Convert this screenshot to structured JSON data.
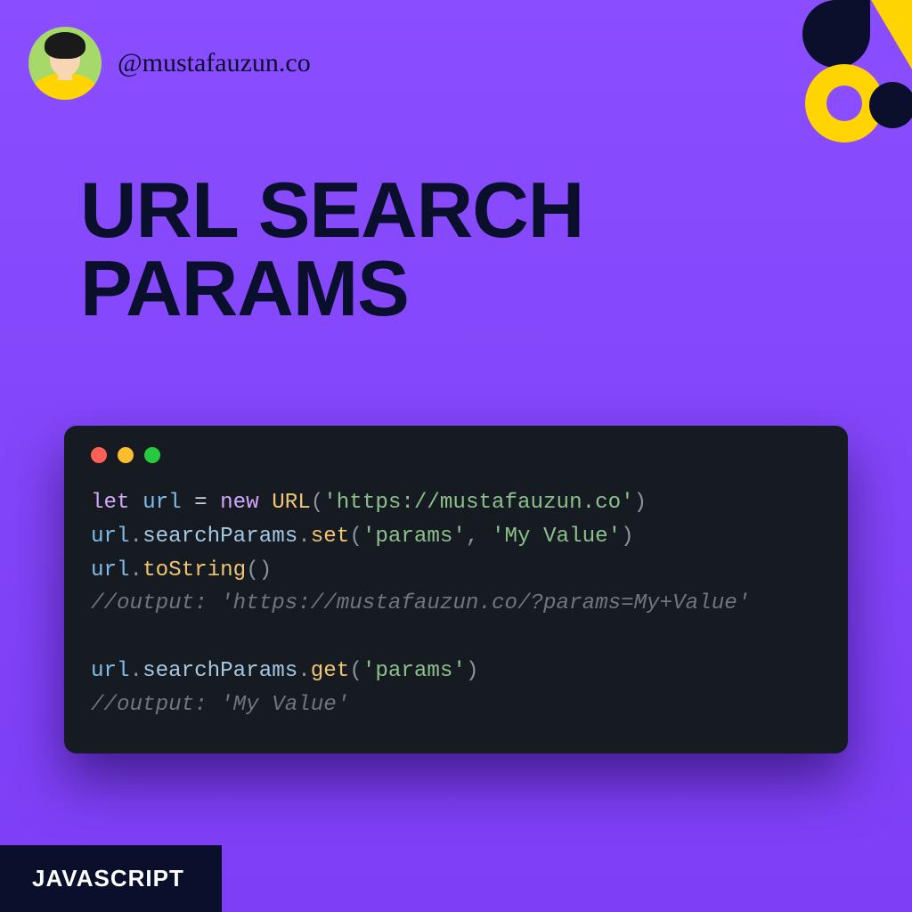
{
  "header": {
    "handle": "@mustafauzun.co"
  },
  "title": "URL SEARCH PARAMS",
  "footer": {
    "tag": "JAVASCRIPT"
  },
  "code": {
    "tokens": [
      [
        {
          "t": "let ",
          "c": "tok-keyword"
        },
        {
          "t": "url ",
          "c": "tok-var"
        },
        {
          "t": "= ",
          "c": "tok-op"
        },
        {
          "t": "new ",
          "c": "tok-keyword"
        },
        {
          "t": "URL",
          "c": "tok-class"
        },
        {
          "t": "(",
          "c": "tok-punct"
        },
        {
          "t": "'https://mustafauzun.co'",
          "c": "tok-string"
        },
        {
          "t": ")",
          "c": "tok-punct"
        }
      ],
      [
        {
          "t": "url",
          "c": "tok-var"
        },
        {
          "t": ".",
          "c": "tok-punct"
        },
        {
          "t": "searchParams",
          "c": "tok-method"
        },
        {
          "t": ".",
          "c": "tok-punct"
        },
        {
          "t": "set",
          "c": "tok-method2"
        },
        {
          "t": "(",
          "c": "tok-punct"
        },
        {
          "t": "'params'",
          "c": "tok-string"
        },
        {
          "t": ", ",
          "c": "tok-punct"
        },
        {
          "t": "'My Value'",
          "c": "tok-string"
        },
        {
          "t": ")",
          "c": "tok-punct"
        }
      ],
      [
        {
          "t": "url",
          "c": "tok-var"
        },
        {
          "t": ".",
          "c": "tok-punct"
        },
        {
          "t": "toString",
          "c": "tok-method2"
        },
        {
          "t": "()",
          "c": "tok-punct"
        }
      ],
      [
        {
          "t": "//output: 'https://mustafauzun.co/?params=My+Value'",
          "c": "tok-comment"
        }
      ],
      [
        {
          "t": "",
          "c": ""
        }
      ],
      [
        {
          "t": "url",
          "c": "tok-var"
        },
        {
          "t": ".",
          "c": "tok-punct"
        },
        {
          "t": "searchParams",
          "c": "tok-method"
        },
        {
          "t": ".",
          "c": "tok-punct"
        },
        {
          "t": "get",
          "c": "tok-method2"
        },
        {
          "t": "(",
          "c": "tok-punct"
        },
        {
          "t": "'params'",
          "c": "tok-string"
        },
        {
          "t": ")",
          "c": "tok-punct"
        }
      ],
      [
        {
          "t": "//output: 'My Value'",
          "c": "tok-comment"
        }
      ]
    ]
  },
  "colors": {
    "bg_top": "#8a4dff",
    "bg_bottom": "#7d3ef5",
    "dark": "#0a0f2c",
    "accent": "#ffd400"
  }
}
